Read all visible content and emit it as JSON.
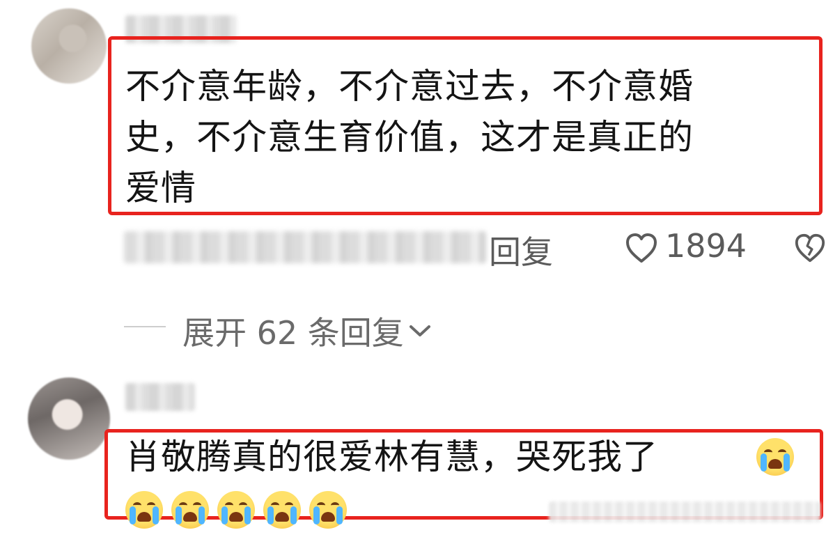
{
  "comments": [
    {
      "text": "不介意年龄，不介意过去，不介意婚史，不介意生育价值，这才是真正的爱情",
      "line1": "不介意年龄，不介意过去，不介意婚",
      "line2": "史，不介意生育价值，这才是真正的",
      "line3": "爱情",
      "reply_label": "回复",
      "like_count": "1894"
    },
    {
      "line1": "肖敬腾真的很爱林有慧，哭死我了"
    }
  ],
  "expand_replies": {
    "label": "展开 62 条回复"
  },
  "icons": {
    "like": "heart-outline-icon",
    "dislike": "broken-heart-icon",
    "chevron": "chevron-down-icon",
    "emoji": "loudly-crying-face-emoji"
  },
  "colors": {
    "highlight_box": "#e8231e",
    "meta_text": "#5b5b5b"
  }
}
